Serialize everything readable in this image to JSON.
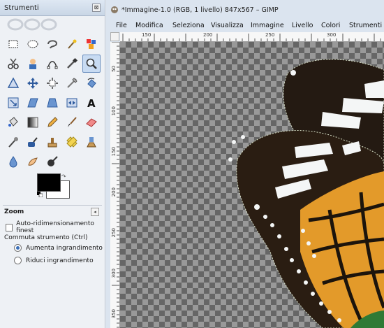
{
  "toolbox": {
    "title": "Strumenti",
    "close_glyph": "⊠",
    "tools": [
      "rect-select-icon",
      "ellipse-select-icon",
      "free-select-icon",
      "fuzzy-select-icon",
      "color-select-icon",
      "scissors-select-icon",
      "foreground-select-icon",
      "paths-icon",
      "color-picker-icon",
      "zoom-icon",
      "measure-icon",
      "move-icon",
      "align-icon",
      "crop-icon",
      "rotate-icon",
      "scale-icon",
      "shear-icon",
      "perspective-icon",
      "flip-icon",
      "text-icon",
      "bucket-fill-icon",
      "blend-icon",
      "pencil-icon",
      "paintbrush-icon",
      "eraser-icon",
      "airbrush-icon",
      "ink-icon",
      "clone-icon",
      "heal-icon",
      "perspective-clone-icon",
      "blur-icon",
      "smudge-icon",
      "dodge-burn-icon"
    ],
    "active_tool": "zoom-icon",
    "fg_color": "#000000",
    "bg_color": "#ffffff",
    "swap_glyph": "↷",
    "options": {
      "title": "Zoom",
      "auto_resize_label": "Auto-ridimensionamento finest",
      "toggle_label": "Commuta strumento  (Ctrl)",
      "zoom_in_label": "Aumenta ingrandimento",
      "zoom_out_label": "Riduci ingrandimento",
      "selected": "zoom_in"
    }
  },
  "image_window": {
    "title": "*Immagine-1.0 (RGB, 1 livello) 847x567 – GIMP",
    "menus": [
      "File",
      "Modifica",
      "Seleziona",
      "Visualizza",
      "Immagine",
      "Livello",
      "Colori",
      "Strumenti"
    ],
    "hruler_labels": [
      "150",
      "200",
      "250",
      "300"
    ],
    "vruler_labels": [
      "50",
      "100",
      "150",
      "200",
      "250",
      "300",
      "350"
    ]
  }
}
